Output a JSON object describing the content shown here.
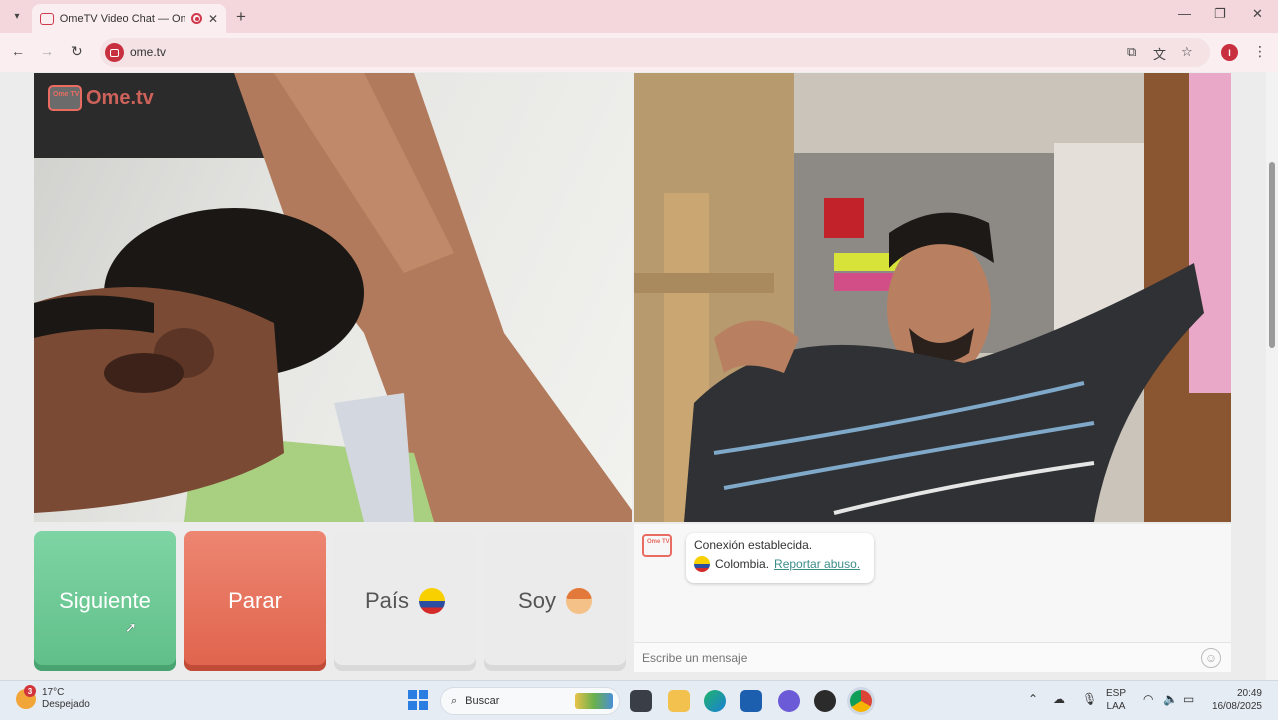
{
  "browser": {
    "tab_title": "OmeTV Video Chat — Omegle",
    "new_tab_symbol": "+",
    "url": "ome.tv",
    "profile_initial": "I"
  },
  "page": {
    "logo_text": "Ome.tv",
    "logo_small": "Ome TV"
  },
  "controls": {
    "next_label": "Siguiente",
    "stop_label": "Parar",
    "country_label": "País",
    "gender_label": "Soy"
  },
  "chat": {
    "status": "Conexión establecida.",
    "country": "Colombia.",
    "report": "Reportar abuso.",
    "input_placeholder": "Escribe un mensaje"
  },
  "taskbar": {
    "weather_badge": "3",
    "temperature": "17°C",
    "condition": "Despejado",
    "search_label": "Buscar",
    "lang_line1": "ESP",
    "lang_line2": "LAA",
    "time": "20:49",
    "date": "16/08/2025"
  },
  "icons": {
    "search": "magnifier-icon",
    "emoji": "smiley-icon"
  }
}
